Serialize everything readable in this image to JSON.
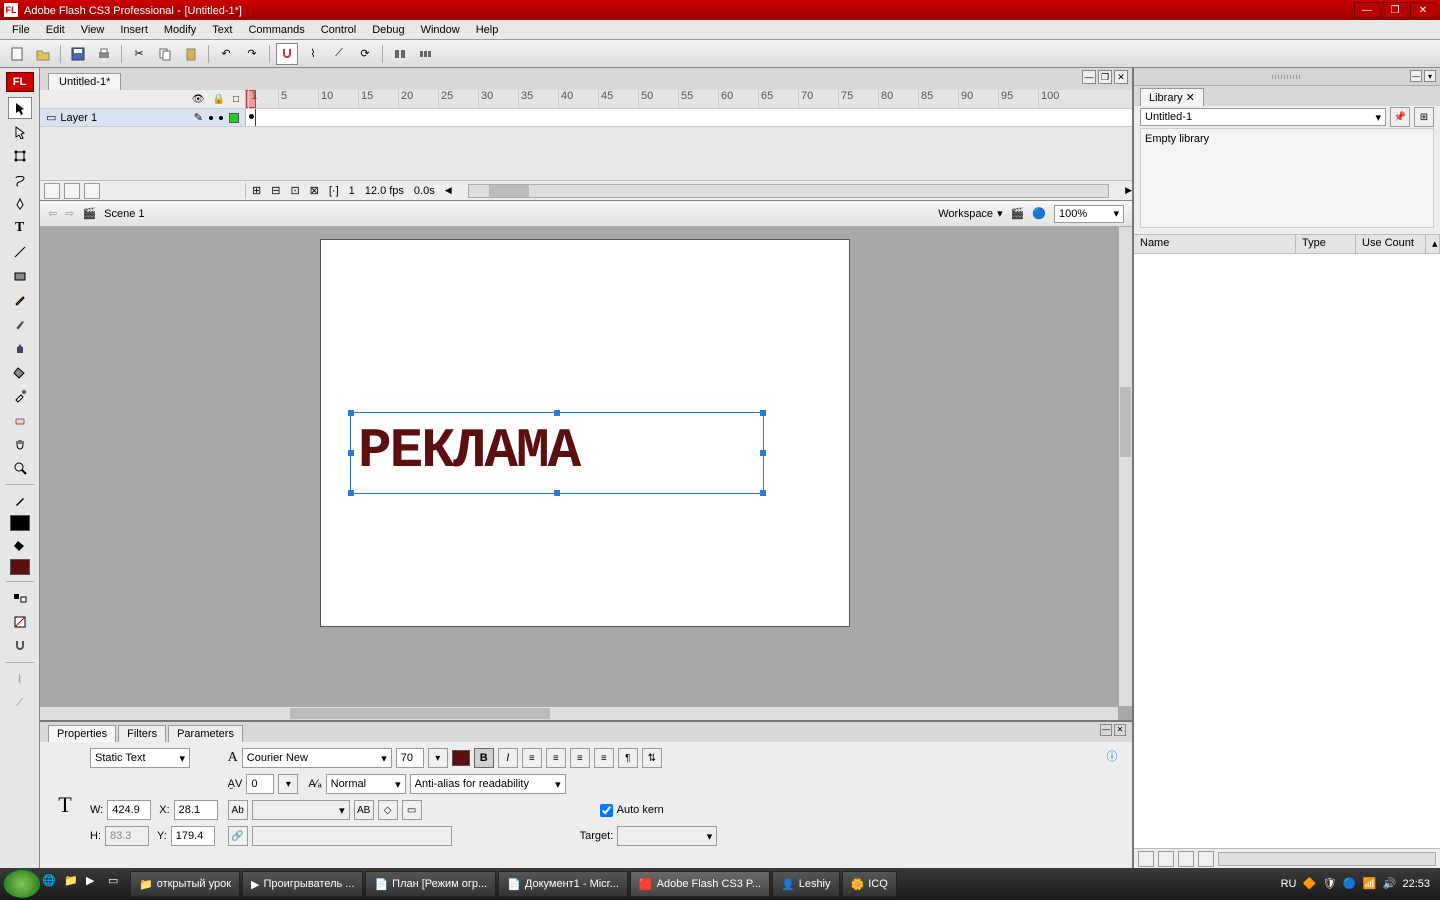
{
  "titlebar": {
    "app": "Adobe Flash CS3 Professional",
    "doc": "[Untitled-1*]"
  },
  "menu": [
    "File",
    "Edit",
    "View",
    "Insert",
    "Modify",
    "Text",
    "Commands",
    "Control",
    "Debug",
    "Window",
    "Help"
  ],
  "doc_tab": "Untitled-1*",
  "layer_name": "Layer 1",
  "timeline_ticks": [
    1,
    5,
    10,
    15,
    20,
    25,
    30,
    35,
    40,
    45,
    50,
    55,
    60,
    65,
    70,
    75,
    80,
    85,
    90,
    95,
    100
  ],
  "tl_status": {
    "frame": "1",
    "fps": "12.0 fps",
    "time": "0.0s"
  },
  "scene": {
    "label": "Scene 1",
    "workspace": "Workspace",
    "zoom": "100%"
  },
  "stage_text": "РЕКЛАМА",
  "stage_text_color": "#5b0f0f",
  "props": {
    "tabs": [
      "Properties",
      "Filters",
      "Parameters"
    ],
    "text_type": "Static Text",
    "font": "Courier New",
    "size": "70",
    "av": "0",
    "position": "Normal",
    "antialias": "Anti-alias for readability",
    "W": "424.9",
    "X": "28.1",
    "H": "83.3",
    "Y": "179.4",
    "auto_kern": "Auto kern",
    "target": "Target:"
  },
  "library": {
    "tab": "Library",
    "doc": "Untitled-1",
    "empty": "Empty library",
    "cols": [
      "Name",
      "Type",
      "Use Count"
    ]
  },
  "taskbar": {
    "items": [
      "открытый урок",
      "Проигрыватель ...",
      "План [Режим огр...",
      "Документ1 - Micr...",
      "Adobe Flash CS3 P...",
      "Leshiy",
      "ICQ"
    ],
    "lang": "RU",
    "time": "22:53"
  }
}
